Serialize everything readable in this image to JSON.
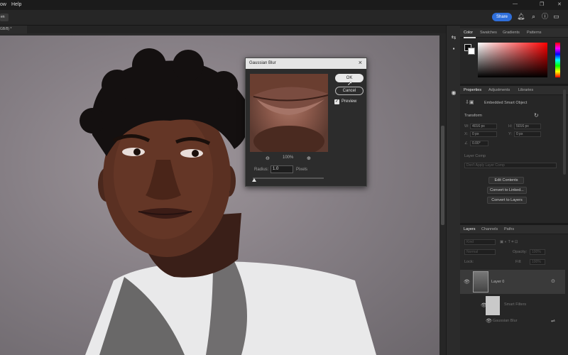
{
  "menu": {
    "items": [
      "ow",
      "Help"
    ]
  },
  "window_controls": [
    "—",
    "❐",
    "✕"
  ],
  "optbar": {
    "open_label": "en"
  },
  "header": {
    "share_label": "Share"
  },
  "doc_tab": {
    "label": "GB/8) *",
    "close": "×"
  },
  "color_panel": {
    "tabs": [
      "Color",
      "Swatches",
      "Gradients",
      "Patterns"
    ],
    "foreground": "#0c0c0c",
    "background": "#ffffff",
    "hue_color": "#ff0000"
  },
  "properties_panel": {
    "tabs": [
      "Properties",
      "Adjustments",
      "Libraries"
    ],
    "object_type": "Embedded Smart Object",
    "transform_label": "Transform",
    "w_label": "W:",
    "w_value": "4016 px",
    "h_label": "H:",
    "h_value": "5016 px",
    "x_label": "X:",
    "x_value": "0 px",
    "y_label": "Y:",
    "y_value": "0 px",
    "angle_value": "0.00°",
    "layer_comp_label": "Layer Comp",
    "layer_comp_placeholder": "Don't Apply Layer Comp",
    "edit_contents_label": "Edit Contents",
    "convert_to_linked_label": "Convert to Linked...",
    "convert_to_layers_label": "Convert to Layers"
  },
  "layers_panel": {
    "tabs": [
      "Layers",
      "Channels",
      "Paths"
    ],
    "kind_placeholder": "Kind",
    "blend_mode": "Normal",
    "opacity_label": "Opacity:",
    "opacity_value": "100%",
    "lock_label": "Lock:",
    "fill_label": "Fill:",
    "fill_value": "100%",
    "layer_name": "Layer 0",
    "smart_filters_label": "Smart Filters",
    "filter_name": "Gaussian Blur"
  },
  "dialog": {
    "title": "Gaussian Blur",
    "ok_label": "OK",
    "cancel_label": "Cancel",
    "preview_label": "Preview",
    "preview_checked": true,
    "zoom_value": "100%",
    "radius_label": "Radius:",
    "radius_value": "1.0",
    "unit_label": "Pixels",
    "radius_slider_fraction": 0.02
  }
}
